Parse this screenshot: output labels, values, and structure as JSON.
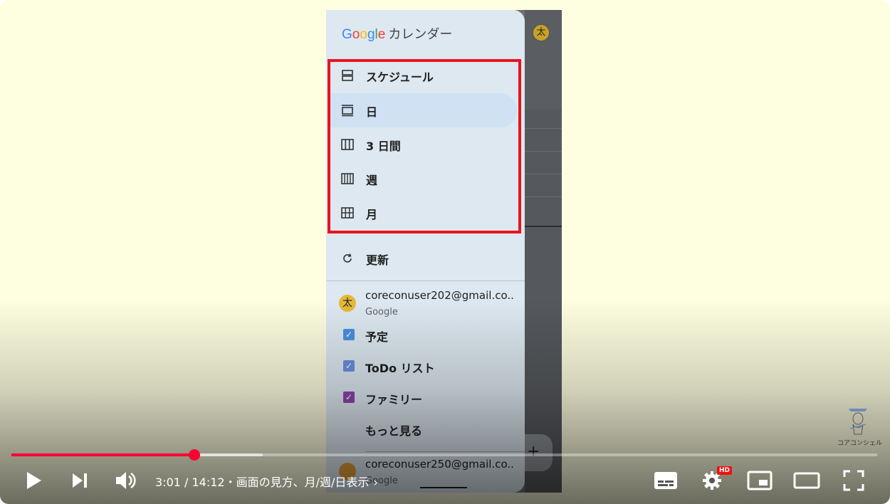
{
  "player": {
    "time_display": "3:01 / 14:12",
    "chapter_title": "・画面の見方、月/週/日表示",
    "chapter_chevron": "›",
    "hd_badge": "HD",
    "progress": {
      "played_fraction": 0.213,
      "buffered_fraction": 0.29
    },
    "watermark_text": "コアコンシェル",
    "accent_color": "#ff0033"
  },
  "phone": {
    "header_avatar": "太",
    "fab_label": "+",
    "drawer": {
      "brand_google": [
        "G",
        "o",
        "o",
        "g",
        "l",
        "e"
      ],
      "brand_google_colors": [
        "#4285F4",
        "#EA4335",
        "#FBBC05",
        "#4285F4",
        "#34A853",
        "#EA4335"
      ],
      "app_name": "カレンダー",
      "views": [
        {
          "label": "スケジュール",
          "icon": "schedule-view-icon"
        },
        {
          "label": "日",
          "icon": "day-view-icon",
          "selected": true
        },
        {
          "label": "3 日間",
          "icon": "three-day-view-icon"
        },
        {
          "label": "週",
          "icon": "week-view-icon"
        },
        {
          "label": "月",
          "icon": "month-view-icon"
        }
      ],
      "refresh_label": "更新",
      "account1": {
        "avatar": "太",
        "email": "coreconuser202@gmail.co..",
        "provider": "Google"
      },
      "calendars": [
        {
          "label": "予定",
          "color": "#4a90e2",
          "checked": true
        },
        {
          "label": "ToDo リスト",
          "color": "#6b8fe0",
          "checked": true
        },
        {
          "label": "ファミリー",
          "color": "#8e44ad",
          "checked": true
        }
      ],
      "more_label": "もっと見る",
      "account2": {
        "email": "coreconuser250@gmail.co..",
        "provider": "Google"
      }
    }
  }
}
